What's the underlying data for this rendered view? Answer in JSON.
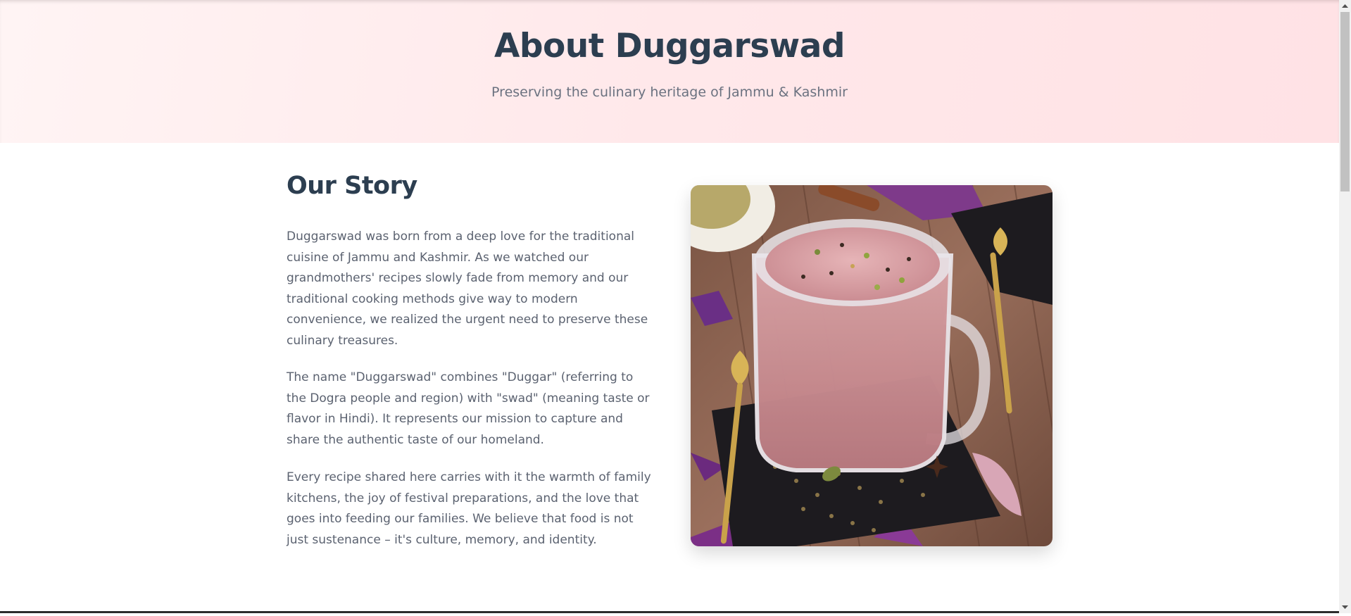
{
  "hero": {
    "title": "About Duggarswad",
    "subtitle": "Preserving the culinary heritage of Jammu & Kashmir"
  },
  "story": {
    "title": "Our Story",
    "paragraphs": [
      "Duggarswad was born from a deep love for the traditional cuisine of Jammu and Kashmir. As we watched our grandmothers' recipes slowly fade from memory and our traditional cooking methods give way to modern convenience, we realized the urgent need to preserve these culinary treasures.",
      "The name \"Duggarswad\" combines \"Duggar\" (referring to the Dogra people and region) with \"swad\" (meaning taste or flavor in Hindi). It represents our mission to capture and share the authentic taste of our homeland.",
      "Every recipe shared here carries with it the warmth of family kitchens, the joy of festival preparations, and the love that goes into feeding our families. We believe that food is not just sustenance – it's culture, memory, and identity."
    ]
  },
  "colors": {
    "heading": "#2c3e50",
    "body_text": "#5b6270",
    "hero_bg": "#ffe8ea"
  }
}
